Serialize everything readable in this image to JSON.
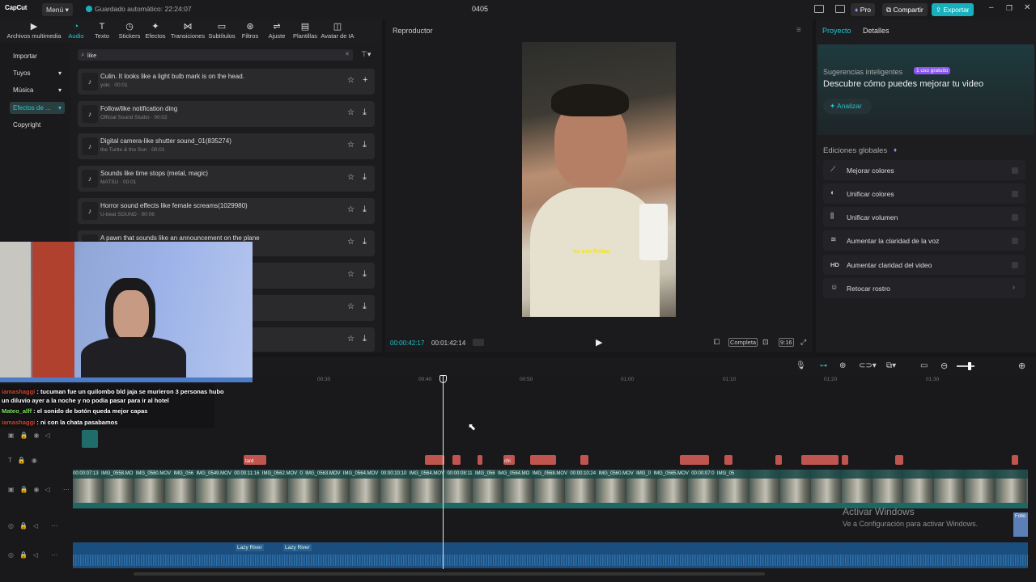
{
  "titlebar": {
    "logo": "CapCut",
    "menu": "Menú",
    "autosave": "Guardado automático: 22:24:07",
    "project": "0405",
    "pro": "Pro",
    "share": "Compartir",
    "export": "Exportar"
  },
  "toolbar": [
    {
      "label": "Archivos multimedia",
      "icon": "▶"
    },
    {
      "label": "Audio",
      "icon": "◔"
    },
    {
      "label": "Texto",
      "icon": "T"
    },
    {
      "label": "Stickers",
      "icon": "◷"
    },
    {
      "label": "Efectos",
      "icon": "✦"
    },
    {
      "label": "Transiciones",
      "icon": "⋈"
    },
    {
      "label": "Subtítulos",
      "icon": "▭"
    },
    {
      "label": "Filtros",
      "icon": "⊛"
    },
    {
      "label": "Ajuste",
      "icon": "⇌"
    },
    {
      "label": "Plantillas",
      "icon": "▤"
    },
    {
      "label": "Avatar de IA",
      "icon": "◫"
    }
  ],
  "categories": [
    "Importar",
    "Tuyos",
    "Música",
    "Efectos de ...",
    "Copyright"
  ],
  "search": {
    "value": "like"
  },
  "audio_items": [
    {
      "title": "Culin. It looks like a light bulb mark is on the head.",
      "sub": "yoki · 00:01"
    },
    {
      "title": "Follow/like notification ding",
      "sub": "Official Sound Studio · 00:02"
    },
    {
      "title": "Digital camera-like shutter sound_01(835274)",
      "sub": "the Turtle & the Sun · 00:01"
    },
    {
      "title": "Sounds like time stops (metal, magic)",
      "sub": "MATSU · 00:01"
    },
    {
      "title": "Horror sound effects like female screams(1029980)",
      "sub": "U-beat SOUND · 00:06"
    },
    {
      "title": "A pawn that sounds like an announcement on the plane",
      "sub": ""
    }
  ],
  "player": {
    "title": "Reproductor",
    "subtitle_text": "no son finitas",
    "current_time": "00:00:42:17",
    "total_time": "00:01:42:14",
    "full_label": "Completa",
    "ratio": "9:16"
  },
  "right": {
    "tab_project": "Proyecto",
    "tab_details": "Detalles",
    "smart_title": "Sugerencias inteligentes",
    "badge": "1 uso gratuito",
    "smart_desc": "Descubre cómo puedes mejorar tu video",
    "analyze": "Analizar",
    "global_title": "Ediciones globales",
    "edits": [
      {
        "icon": "⟋",
        "label": "Mejorar colores"
      },
      {
        "icon": "◐",
        "label": "Unificar colores"
      },
      {
        "icon": "⫼",
        "label": "Unificar volumen"
      },
      {
        "icon": "≋",
        "label": "Aumentar la claridad de la voz"
      },
      {
        "icon": "HD",
        "label": "Aumentar claridad del video"
      },
      {
        "icon": "☺",
        "label": "Retocar rostro"
      }
    ]
  },
  "timeline": {
    "ticks": [
      "00:30",
      "00:40",
      "00:50",
      "01:00",
      "01:10",
      "01:20",
      "01:30"
    ],
    "chat": [
      {
        "user": "iamashaggi",
        "text": "tucuman fue un quilombo bld jaja se murieron 3 personas hubo"
      },
      {
        "user": "",
        "text": "un diluvio ayer a la noche y no podia pasar para ir al hotel"
      },
      {
        "user": "Mateo_alff",
        "text": "el sonido de botón queda mejor capas"
      },
      {
        "user": "iamashaggi",
        "text": "ni con la chata pasabamos"
      }
    ],
    "clip_labels": [
      "00:00:07:13",
      "IMG_0558.MO",
      "IMG_0560.MOV",
      "IMG_056",
      "IMG_0549.MOV",
      "00:00:11:16",
      "IMG_0562.MOV",
      "0",
      "IMG_0563.MOV",
      "IMG_0564.MOV",
      "00:00:10:10",
      "IMG_0564.MOV",
      "00:00:08:11",
      "IMG_056",
      "IMG_0564.MO",
      "IMG_0568.MOV",
      "00:00:10:24",
      "IMG_0560.MOV",
      "IMG_0",
      "IMG_0565.MOV",
      "00:00:07:0",
      "IMG_05"
    ],
    "text_clips": [
      "tard",
      "chi"
    ],
    "audio_labels": [
      "Lazy River",
      "Lazy River"
    ],
    "follow_clip": "Follo"
  },
  "watermark": {
    "line1": "Activar Windows",
    "line2": "Ve a Configuración para activar Windows."
  },
  "colors": {
    "accent": "#22c6cf",
    "export_bg": "#17b0bd",
    "red_clip": "#c0554f",
    "audio_clip": "#1a4e7e"
  }
}
